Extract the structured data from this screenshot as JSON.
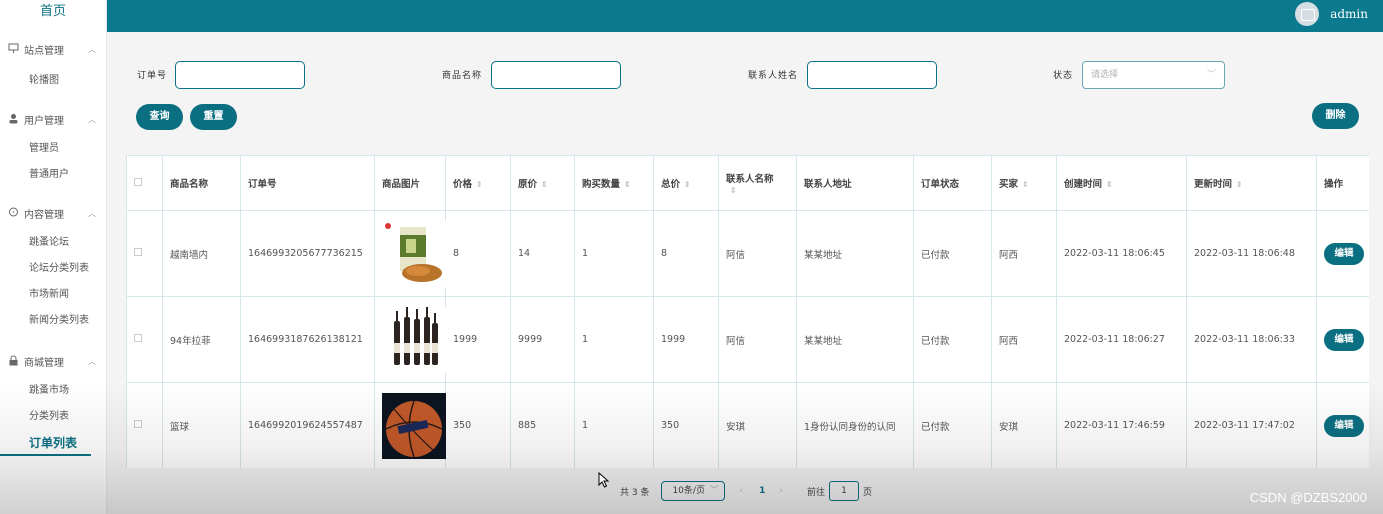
{
  "sidebar": {
    "home": "首页",
    "groups": [
      {
        "label": "站点管理",
        "items": [
          "轮播图"
        ]
      },
      {
        "label": "用户管理",
        "items": [
          "管理员",
          "普通用户"
        ]
      },
      {
        "label": "内容管理",
        "items": [
          "跳蚤论坛",
          "论坛分类列表",
          "市场新闻",
          "新闻分类列表"
        ]
      },
      {
        "label": "商城管理",
        "items": [
          "跳蚤市场",
          "分类列表",
          "订单列表"
        ]
      }
    ]
  },
  "topbar": {
    "user": "admin"
  },
  "filters": {
    "order_no_label": "订单号",
    "product_name_label": "商品名称",
    "contact_name_label": "联系人姓名",
    "status_label": "状态",
    "status_placeholder": "请选择"
  },
  "buttons": {
    "query": "查询",
    "reset": "重置",
    "delete": "删除",
    "edit": "编辑"
  },
  "table": {
    "headers": [
      "商品名称",
      "订单号",
      "商品图片",
      "价格",
      "原价",
      "购买数量",
      "总价",
      "联系人名称",
      "联系人地址",
      "订单状态",
      "买家",
      "创建时间",
      "更新时间",
      "操作"
    ],
    "rows": [
      {
        "name": "越南墙内",
        "order_no": "1646993205677736215",
        "price": "8",
        "orig": "14",
        "qty": "1",
        "total": "8",
        "contact": "阿信",
        "address": "某某地址",
        "status": "已付款",
        "buyer": "阿西",
        "created": "2022-03-11 18:06:45",
        "updated": "2022-03-11 18:06:48"
      },
      {
        "name": "94年拉菲",
        "order_no": "1646993187626138121",
        "price": "1999",
        "orig": "9999",
        "qty": "1",
        "total": "1999",
        "contact": "阿信",
        "address": "某某地址",
        "status": "已付款",
        "buyer": "阿西",
        "created": "2022-03-11 18:06:27",
        "updated": "2022-03-11 18:06:33"
      },
      {
        "name": "篮球",
        "order_no": "1646992019624557487",
        "price": "350",
        "orig": "885",
        "qty": "1",
        "total": "350",
        "contact": "安琪",
        "address": "1身份认同身份的认同",
        "status": "已付款",
        "buyer": "安琪",
        "created": "2022-03-11 17:46:59",
        "updated": "2022-03-11 17:47:02"
      }
    ]
  },
  "pagination": {
    "total": "共 3 条",
    "page_size": "10条/页",
    "prev": "‹",
    "current": "1",
    "next": "›",
    "goto": "前往",
    "goto_value": "1",
    "page_unit": "页"
  },
  "watermark": "CSDN @DZBS2000",
  "colors": {
    "primary": "#0b7285",
    "topbar": "#0b7a8e"
  }
}
